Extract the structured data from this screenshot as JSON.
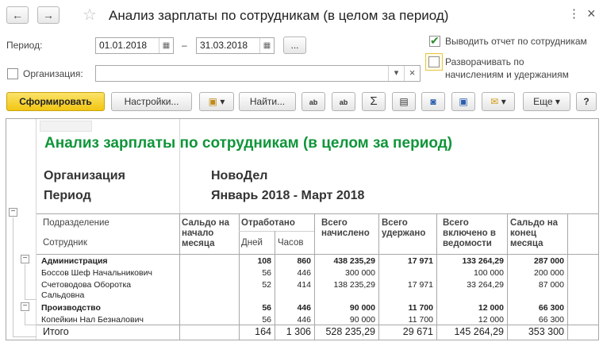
{
  "window": {
    "title": "Анализ зарплаты по сотрудникам (в целом за период)",
    "back_icon": "←",
    "forward_icon": "→",
    "star_icon": "☆",
    "more_icon": "⋮",
    "close_icon": "×"
  },
  "form": {
    "period_label": "Период:",
    "period_from": "01.01.2018",
    "period_dash": "–",
    "period_to": "31.03.2018",
    "period_select_label": "...",
    "organization_label": "Организация:",
    "organization_value": "",
    "dropdown_icon": "▾",
    "clear_icon": "×",
    "show_by_employees_label": "Выводить отчет по сотрудникам",
    "show_by_employees_checked": true,
    "expand_label_line1": "Разворачивать по",
    "expand_label_line2": "начислениям и удержаниям",
    "expand_checked": false,
    "organization_checked": false
  },
  "toolbar": {
    "generate_label": "Сформировать",
    "settings_label": "Настройки...",
    "find_label": "Найти...",
    "more_label": "Еще",
    "help_label": "?",
    "sum_icon": "Σ",
    "chevron_icon": "▾"
  },
  "report": {
    "title": "Анализ зарплаты по сотрудникам (в целом за период)",
    "org_label": "Организация",
    "org_value": "НовоДел",
    "period_label": "Период",
    "period_value": "Январь 2018 - Март 2018",
    "headers": {
      "subdivision": "Подразделение",
      "employee": "Сотрудник",
      "saldo_start_1": "Сальдо на",
      "saldo_start_2": "начало",
      "saldo_start_3": "месяца",
      "worked": "Отработано",
      "days": "Дней",
      "hours": "Часов",
      "accrued_1": "Всего",
      "accrued_2": "начислено",
      "withheld_1": "Всего",
      "withheld_2": "удержано",
      "included_1": "Всего",
      "included_2": "включено в",
      "included_3": "ведомости",
      "saldo_end_1": "Сальдо на",
      "saldo_end_2": "конец",
      "saldo_end_3": "месяца"
    },
    "rows": [
      {
        "name": "Администрация",
        "name2": "",
        "days": "108",
        "hours": "860",
        "accrued": "438 235,29",
        "withheld": "17 971",
        "included": "133 264,29",
        "saldo_end": "287 000",
        "bold": true
      },
      {
        "name": "Боссов Шеф Начальникович",
        "name2": "",
        "days": "56",
        "hours": "446",
        "accrued": "300 000",
        "withheld": "",
        "included": "100 000",
        "saldo_end": "200 000",
        "bold": false
      },
      {
        "name": "Счетоводова Оборотка",
        "name2": "Сальдовна",
        "days": "52",
        "hours": "414",
        "accrued": "138 235,29",
        "withheld": "17 971",
        "included": "33 264,29",
        "saldo_end": "87 000",
        "bold": false
      },
      {
        "name": "Производство",
        "name2": "",
        "days": "56",
        "hours": "446",
        "accrued": "90 000",
        "withheld": "11 700",
        "included": "12 000",
        "saldo_end": "66 300",
        "bold": true
      },
      {
        "name": "Копейкин Нал Безналович",
        "name2": "",
        "days": "56",
        "hours": "446",
        "accrued": "90 000",
        "withheld": "11 700",
        "included": "12 000",
        "saldo_end": "66 300",
        "bold": false
      }
    ],
    "total": {
      "name": "Итого",
      "days": "164",
      "hours": "1 306",
      "accrued": "528 235,29",
      "withheld": "29 671",
      "included": "145 264,29",
      "saldo_end": "353 300"
    },
    "collapse_icon": "−"
  }
}
